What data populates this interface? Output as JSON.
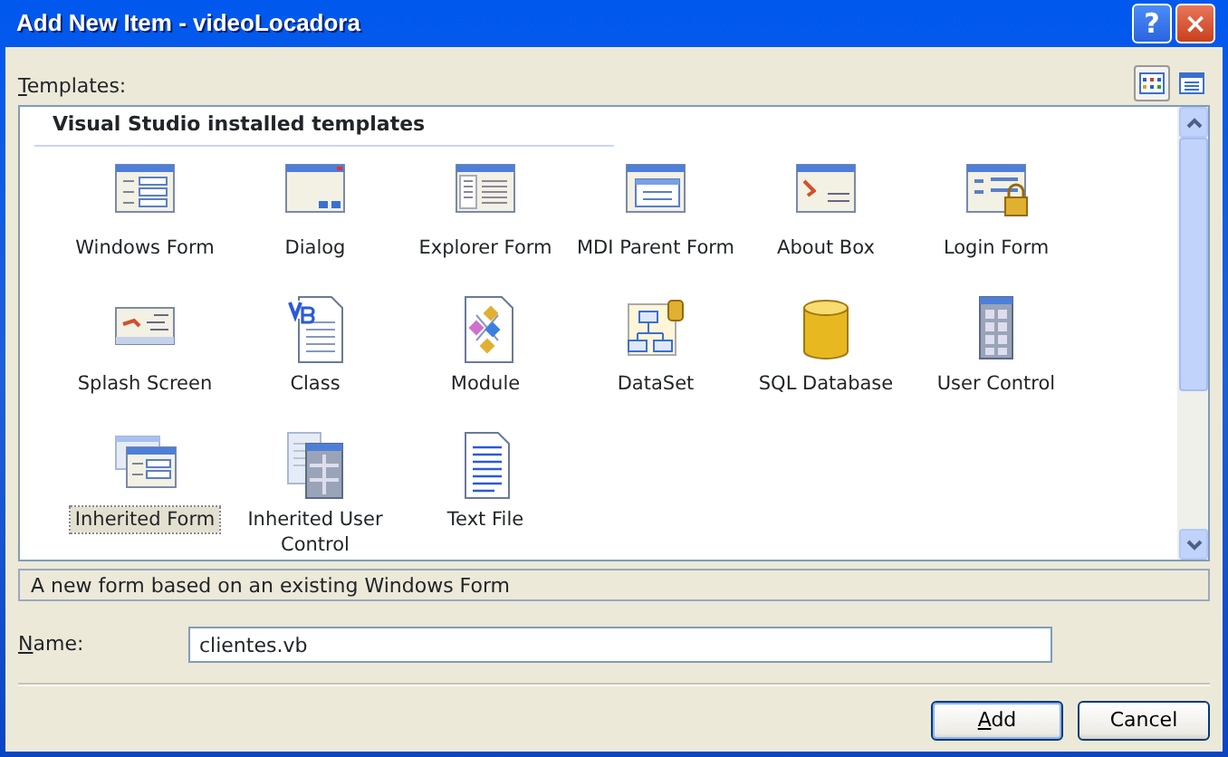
{
  "window": {
    "title": "Add New Item - videoLocadora"
  },
  "title_buttons": [
    {
      "kind": "help",
      "label": "?"
    },
    {
      "kind": "close",
      "label": "×"
    }
  ],
  "templates_label": {
    "text": "Templates:"
  },
  "view_buttons": [
    {
      "kind": "large",
      "selected": true
    },
    {
      "kind": "small",
      "selected": false
    }
  ],
  "templates": {
    "group": "Visual Studio installed templates",
    "items": [
      {
        "label": "Windows Form",
        "kind": "form",
        "selected": false
      },
      {
        "label": "Dialog",
        "kind": "dialog",
        "selected": false
      },
      {
        "label": "Explorer Form",
        "kind": "explorer",
        "selected": false
      },
      {
        "label": "MDI Parent Form",
        "kind": "mdi",
        "selected": false
      },
      {
        "label": "About Box",
        "kind": "about",
        "selected": false
      },
      {
        "label": "Login Form",
        "kind": "login",
        "selected": false
      },
      {
        "label": "Splash Screen",
        "kind": "splash",
        "selected": false
      },
      {
        "label": "Class",
        "kind": "class",
        "selected": false
      },
      {
        "label": "Module",
        "kind": "module",
        "selected": false
      },
      {
        "label": "DataSet",
        "kind": "dataset",
        "selected": false
      },
      {
        "label": "SQL Database",
        "kind": "database",
        "selected": false
      },
      {
        "label": "User Control",
        "kind": "usercontrol",
        "selected": false
      },
      {
        "label": "Inherited Form",
        "kind": "inherited",
        "selected": true
      },
      {
        "label": "Inherited User Control",
        "kind": "inheriteduc",
        "selected": false
      },
      {
        "label": "Text File",
        "kind": "text",
        "selected": false
      }
    ]
  },
  "description": "A new form based on an existing Windows Form",
  "name_field": {
    "label": "Name:",
    "value": "clientes.vb"
  },
  "buttons": [
    {
      "label": "Add",
      "default": true
    },
    {
      "label": "Cancel",
      "default": false
    }
  ]
}
